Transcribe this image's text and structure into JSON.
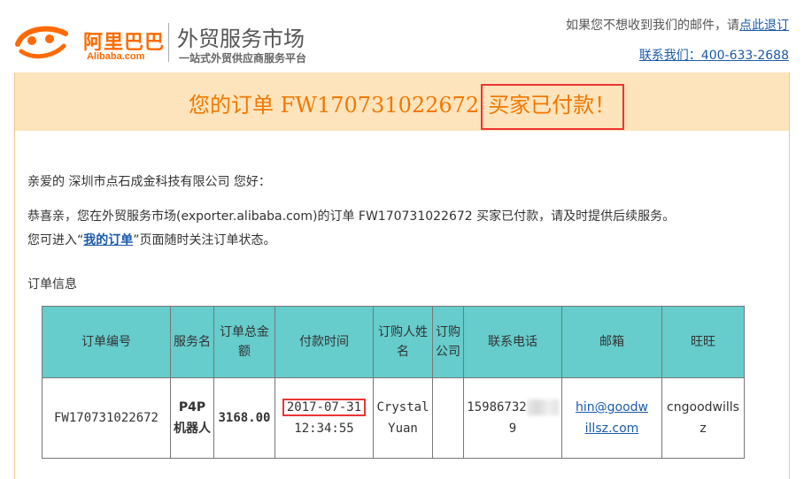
{
  "header": {
    "logo_cn": "阿里巴巴",
    "logo_en": "Alibaba.com",
    "brand_title": "外贸服务市场",
    "brand_subtitle": "一站式外贸供应商服务平台",
    "unsubscribe_prefix": "如果您不想收到我们的邮件，请",
    "unsubscribe_link": "点此退订",
    "contact": "联系我们：400-633-2688"
  },
  "banner": {
    "prefix": "您的订单 FW170731022672",
    "status": "买家已付款！"
  },
  "body": {
    "greeting": "亲爱的 深圳市点石成金科技有限公司 您好：",
    "line1": "恭喜亲，您在外贸服务市场(exporter.alibaba.com)的订单 FW170731022672 买家已付款，请及时提供后续服务。",
    "line2_prefix": "您可进入“",
    "line2_link": "我的订单",
    "line2_suffix": "”页面随时关注订单状态。",
    "section_title": "订单信息"
  },
  "table": {
    "headers": {
      "order_no": "订单编号",
      "service": "服务名",
      "amount": "订单总金额",
      "pay_time": "付款时间",
      "buyer": "订购人姓名",
      "company": "订购公司",
      "phone": "联系电话",
      "email": "邮箱",
      "wangwang": "旺旺"
    },
    "row": {
      "order_no": "FW170731022672",
      "service": "P4P机器人",
      "amount": "3168.00",
      "pay_date": "2017-07-31",
      "pay_clock": "12:34:55",
      "buyer": "Crystal Yuan",
      "company": "",
      "phone_a": "15986732",
      "phone_b": "9",
      "email_a": "hin@goodw",
      "email_b": "illsz.com",
      "wangwang": "cngoodwillsz"
    }
  },
  "colors": {
    "accent_orange": "#f07800",
    "banner_bg": "#fde4bc",
    "table_header_bg": "#66cccc",
    "link_blue": "#1a5aa8",
    "highlight_red": "#ee3333"
  }
}
